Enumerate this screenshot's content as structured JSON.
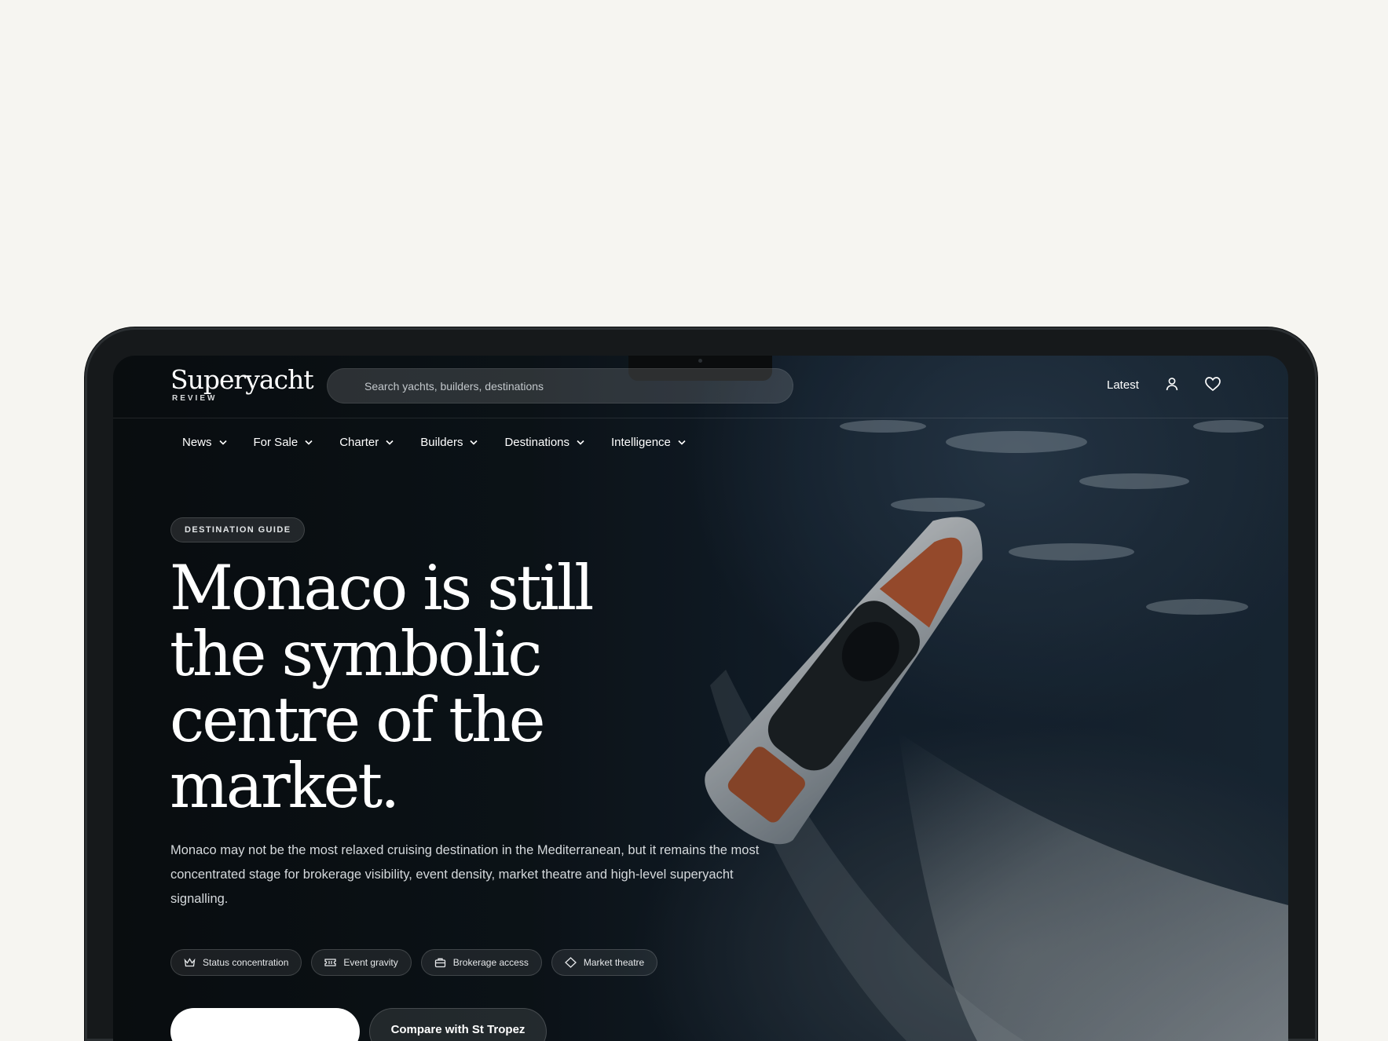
{
  "brand": {
    "name": "Superyacht",
    "sub": "REVIEW"
  },
  "search": {
    "placeholder": "Search yachts, builders, destinations"
  },
  "header": {
    "latest_label": "Latest"
  },
  "nav": {
    "items": [
      {
        "label": "News"
      },
      {
        "label": "For Sale"
      },
      {
        "label": "Charter"
      },
      {
        "label": "Builders"
      },
      {
        "label": "Destinations"
      },
      {
        "label": "Intelligence"
      }
    ]
  },
  "hero": {
    "badge": "DESTINATION GUIDE",
    "headline": "Monaco is still the symbolic centre of the market.",
    "lede": "Monaco may not be the most relaxed cruising destination in the Mediterranean, but it remains the most concentrated stage for brokerage visibility, event density, market theatre and high-level superyacht signalling.",
    "chips": [
      {
        "label": "Status concentration",
        "icon": "crown-icon"
      },
      {
        "label": "Event gravity",
        "icon": "ticket-icon"
      },
      {
        "label": "Brokerage access",
        "icon": "briefcase-icon"
      },
      {
        "label": "Market theatre",
        "icon": "diamond-icon"
      }
    ],
    "secondary_cta": "Compare with St Tropez"
  }
}
